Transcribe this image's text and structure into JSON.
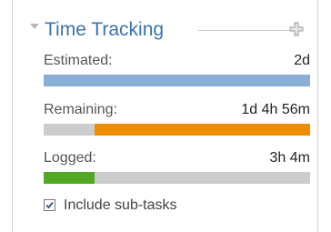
{
  "panel": {
    "title": "Time Tracking",
    "collapse_icon": "triangle-down-icon",
    "add_icon": "plus-icon"
  },
  "rows": [
    {
      "label": "Estimated:",
      "value": "2d",
      "fill_fraction": 1.0,
      "fill_side": "left",
      "color": "#89afd7"
    },
    {
      "label": "Remaining:",
      "value": "1d 4h 56m",
      "fill_fraction": 0.81,
      "fill_side": "right",
      "color": "#ec8e00"
    },
    {
      "label": "Logged:",
      "value": "3h 4m",
      "fill_fraction": 0.19,
      "fill_side": "left",
      "color": "#51a825"
    }
  ],
  "subtasks": {
    "label": "Include sub-tasks",
    "checked": true
  },
  "colors": {
    "title": "#3b73af",
    "track": "#cccccc"
  }
}
